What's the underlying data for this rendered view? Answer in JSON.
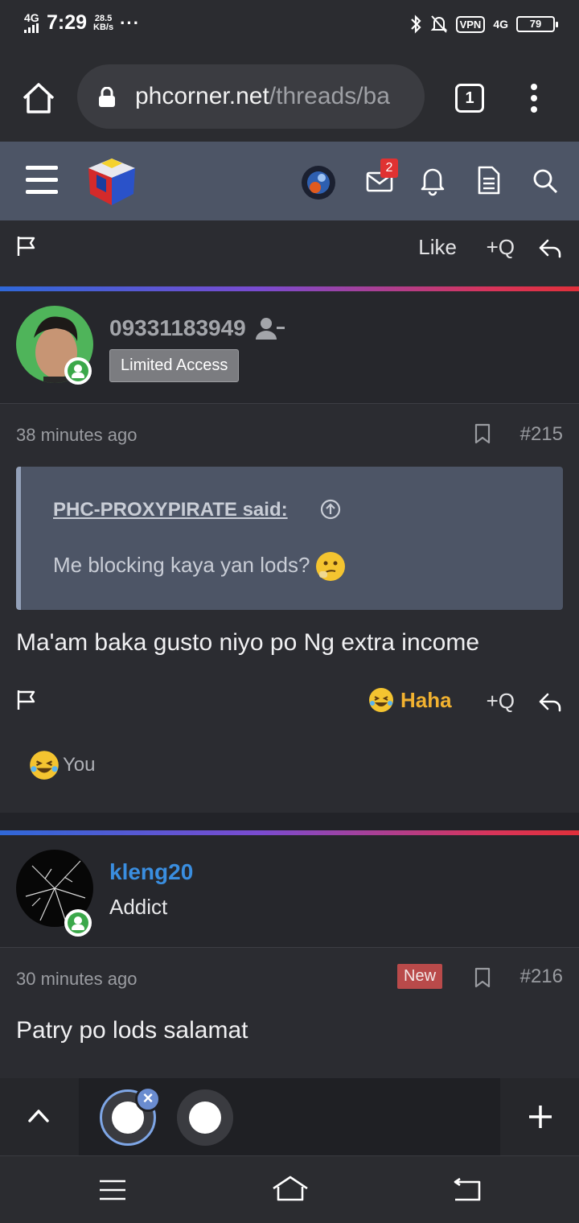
{
  "status_bar": {
    "network": "4G",
    "time": "7:29",
    "speed_value": "28.5",
    "speed_unit": "KB/s",
    "more": "···",
    "vpn": "VPN",
    "network_right": "4G",
    "battery": "79"
  },
  "browser": {
    "url_domain": "phcorner.net",
    "url_path": "/threads/ba",
    "tab_count": "1"
  },
  "site_nav": {
    "messages_badge": "2"
  },
  "prev_post_actions": {
    "like": "Like",
    "quote": "+Q"
  },
  "post_215": {
    "username": "09331183949",
    "user_title": "Limited Access",
    "time": "38 minutes ago",
    "number": "#215",
    "quote_author": "PHC-PROXYPIRATE said:",
    "quote_text": "Me blocking kaya yan lods?",
    "body": "Ma'am baka gusto niyo po Ng extra income",
    "reaction_label": "Haha",
    "quote_action": "+Q",
    "reactions_by": "You"
  },
  "post_216": {
    "username": "kleng20",
    "user_title": "Addict",
    "time": "30 minutes ago",
    "badge": "New",
    "number": "#216",
    "body": "Patry po lods salamat"
  },
  "colors": {
    "accent_blue": "#3a8ee0",
    "username_grey": "#a3a5aa",
    "haha_gold": "#f2b230",
    "new_badge": "#b94a4a"
  }
}
